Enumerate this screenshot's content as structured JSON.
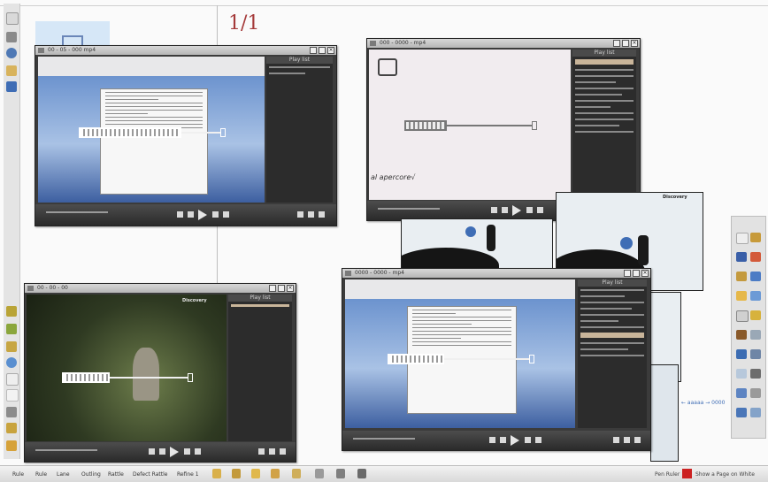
{
  "board": {
    "page_counter": "1/1"
  },
  "players": [
    {
      "id": "top-left",
      "title": "00 - 05 - 000 mp4",
      "playlist_title": "Play list"
    },
    {
      "id": "top-right",
      "title": "000 - 0000 - mp4",
      "playlist_title": "Play list",
      "caption": "al apercore√"
    },
    {
      "id": "bottom-left",
      "title": "00 - 00 - 00",
      "playlist_title": "Play list",
      "watermark": "Discovery"
    },
    {
      "id": "bottom-right",
      "title": "0000 - 0000 - mp4",
      "playlist_title": "Play list"
    }
  ],
  "snow_watermark": "Discovery",
  "side_link": "← aaaaa → 0000",
  "bottom_tabs": [
    "Rule",
    "Rule",
    "Lane",
    "Outling",
    "Rattle",
    "Defect Rattle",
    "Refine 1"
  ],
  "bottom_status": "Pen Ruler",
  "bottom_right_text": "Show a Page on White",
  "colors": {
    "accent_red": "#cc2222",
    "page_counter": "#a53a3a",
    "player_bg": "#3b3b3b",
    "playlist_bg": "#2c2c2c"
  },
  "icons": {
    "left_tools": [
      "pointer-icon",
      "pen-icon",
      "zoom-icon",
      "eraser-icon",
      "hand-icon"
    ],
    "left_bottom_tools": [
      "folder-icon",
      "arrow-icon",
      "highlighter-icon",
      "circle-icon",
      "square-icon",
      "blank-icon",
      "blank-icon",
      "screen-icon",
      "pencil-icon",
      "triangle-icon"
    ],
    "right_tools": [
      "square-icon",
      "select-icon",
      "pen-icon",
      "marker-icon",
      "line-icon",
      "shape-icon",
      "text-icon",
      "fill-icon",
      "eraser-icon",
      "color-icon",
      "image-icon",
      "capture-icon",
      "undo-icon",
      "redo-icon",
      "clear-icon",
      "trash-icon"
    ]
  }
}
